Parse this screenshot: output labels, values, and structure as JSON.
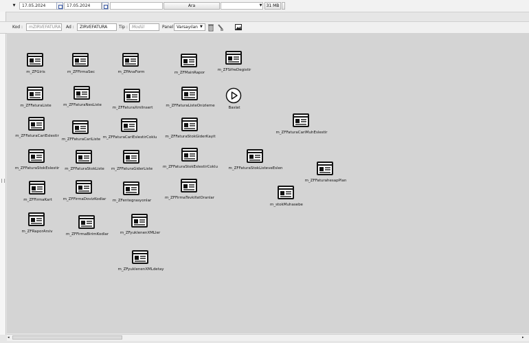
{
  "toolbar": {
    "date_from": "17.05.2024",
    "date_to": "17.05.2024",
    "search_value": "",
    "search_button": "Ara",
    "select_value": "",
    "memory": "31 MB"
  },
  "filterbar": {
    "kod_label": "Kod :",
    "kod_value": "mZIRVEFATURA",
    "ad_label": "Ad :",
    "ad_value": "ZIRVEFATURA",
    "tip_label": "Tip :",
    "tip_value": "Modül",
    "panel_label": "Panel",
    "panel_value": "Varsayılan"
  },
  "items": [
    "m_ZFGiris",
    "m_ZFFirmaSec",
    "m_ZFAnaForm",
    "m_ZFMainRapor",
    "m_ZFSifreDegistir",
    "m_ZFFaturaListe",
    "m_ZFFaturaNesListe",
    "m_ZFFaturaXmlInsert",
    "m_ZFFaturaListeOnizleme",
    "Baslat",
    "m_ZFFaturaCariEslestir",
    "m_ZFFaturaCariListe",
    "m_ZFFaturaCariEslestirCoklu",
    "m_ZFFaturaStokGiderKayit",
    "m_ZFFaturaCariMuhEslestir",
    "m_ZFFaturaStokEslestir",
    "m_ZFFaturaStokListe",
    "m_ZFFaturaGiderListe",
    "m_ZFFaturaStokEslestirCoklu",
    "m_ZFFaturaStokListeveEslen",
    "m_ZFFaturahesapPlan",
    "m_ZFFirmaKart",
    "m_ZFFirmaDovizKodlar",
    "m_ZFentegrasyonlar",
    "m_ZFFirmaTevkifatOranlar",
    "m_stokMuhasebe",
    "m_ZFRaporArsiv",
    "m_ZFFirmaBirimKodlar",
    "m_ZFyuklenenXMLler",
    "m_ZFyuklenenXMLdetay"
  ]
}
